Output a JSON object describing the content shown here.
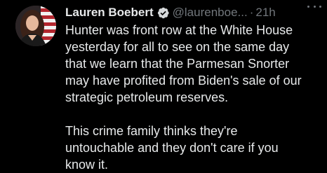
{
  "tweet": {
    "display_name": "Lauren Boebert",
    "handle": "@laurenboe...",
    "separator": "·",
    "time": "21h",
    "paragraphs": [
      "Hunter was front row at the White House\nyesterday for all to see on the same day\nthat we learn that the Parmesan Snorter\nmay have profited from Biden's sale of our\nstrategic petroleum reserves.",
      "This crime family thinks they're\nuntouchable and they don't care if you\nknow it."
    ]
  },
  "colors": {
    "background": "#000000",
    "text": "#e7e9ea",
    "secondary_text": "#71767b",
    "verified_badge": "#1d9bf0"
  },
  "icons": {
    "verified": "verified-badge-icon",
    "more": "more-options-icon"
  }
}
